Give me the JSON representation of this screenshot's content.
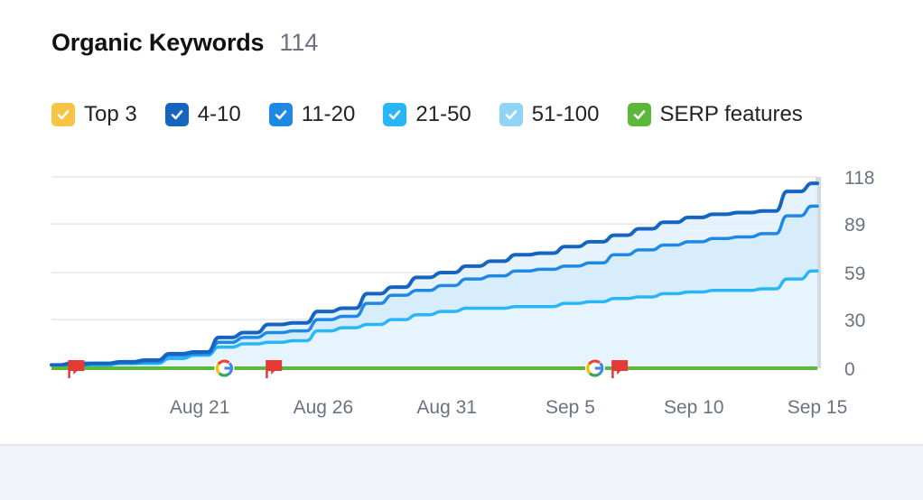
{
  "header": {
    "title": "Organic Keywords",
    "count": "114"
  },
  "legend": [
    {
      "label": "Top 3",
      "color": "#f6c344",
      "checked": true
    },
    {
      "label": "4-10",
      "color": "#1565c0",
      "checked": true
    },
    {
      "label": "11-20",
      "color": "#1e88e5",
      "checked": true
    },
    {
      "label": "21-50",
      "color": "#29b6f6",
      "checked": true
    },
    {
      "label": "51-100",
      "color": "#8fd3f7",
      "checked": true
    },
    {
      "label": "SERP features",
      "color": "#5cb83a",
      "checked": true
    }
  ],
  "chart_data": {
    "type": "area",
    "ylim": [
      0,
      118
    ],
    "yticks": [
      0,
      30,
      59,
      89,
      118
    ],
    "xticks": [
      "Aug 21",
      "Aug 26",
      "Aug 31",
      "Sep 5",
      "Sep 10",
      "Sep 15"
    ],
    "x": [
      "Aug 15",
      "Aug 16",
      "Aug 17",
      "Aug 18",
      "Aug 19",
      "Aug 20",
      "Aug 21",
      "Aug 22",
      "Aug 23",
      "Aug 24",
      "Aug 25",
      "Aug 26",
      "Aug 27",
      "Aug 28",
      "Aug 29",
      "Aug 30",
      "Aug 31",
      "Sep 1",
      "Sep 2",
      "Sep 3",
      "Sep 4",
      "Sep 5",
      "Sep 6",
      "Sep 7",
      "Sep 8",
      "Sep 9",
      "Sep 10",
      "Sep 11",
      "Sep 12",
      "Sep 13",
      "Sep 14",
      "Sep 15"
    ],
    "series": [
      {
        "name": "4-10",
        "color": "#1565c0",
        "values": [
          2,
          3,
          3,
          4,
          5,
          9,
          10,
          19,
          22,
          27,
          28,
          35,
          37,
          46,
          50,
          56,
          59,
          63,
          66,
          70,
          71,
          75,
          78,
          82,
          86,
          90,
          93,
          95,
          96,
          97,
          109,
          114
        ]
      },
      {
        "name": "11-20",
        "color": "#1e88e5",
        "values": [
          2,
          2,
          3,
          3,
          4,
          8,
          9,
          16,
          19,
          22,
          23,
          30,
          32,
          40,
          45,
          48,
          51,
          55,
          57,
          60,
          61,
          63,
          65,
          70,
          73,
          76,
          78,
          80,
          81,
          83,
          94,
          100
        ]
      },
      {
        "name": "21-50",
        "color": "#29b6f6",
        "values": [
          2,
          2,
          2,
          3,
          3,
          6,
          8,
          13,
          15,
          16,
          17,
          23,
          25,
          27,
          30,
          33,
          35,
          37,
          37,
          38,
          38,
          40,
          41,
          43,
          44,
          46,
          47,
          48,
          48,
          49,
          55,
          60
        ]
      },
      {
        "name": "SERP features",
        "color": "#5cb83a",
        "values": [
          0,
          0,
          0,
          0,
          0,
          0,
          0,
          0,
          0,
          0,
          0,
          0,
          0,
          0,
          0,
          0,
          0,
          0,
          0,
          0,
          0,
          0,
          0,
          0,
          0,
          0,
          0,
          0,
          0,
          0,
          0,
          0
        ]
      }
    ],
    "annotations": [
      {
        "type": "flag",
        "x": "Aug 16",
        "color": "#e53935"
      },
      {
        "type": "google-update",
        "x": "Aug 22"
      },
      {
        "type": "flag",
        "x": "Aug 24",
        "color": "#e53935"
      },
      {
        "type": "google-update",
        "x": "Sep 6"
      },
      {
        "type": "flag",
        "x": "Sep 7",
        "color": "#e53935"
      }
    ]
  }
}
